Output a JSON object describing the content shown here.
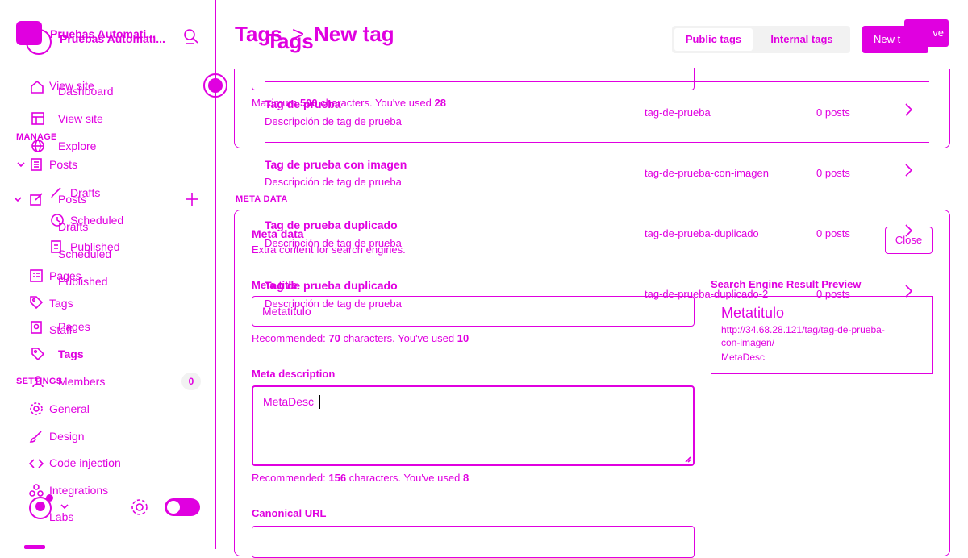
{
  "sidebar": {
    "site_title_a": "Pruebas Automati...",
    "site_title_b": "Pruebas Automati...",
    "search_label": "search",
    "nav_a": {
      "dashboard": "Dashboard",
      "view_site": "View site",
      "explore": "Explore",
      "posts": "Posts",
      "drafts": "Drafts",
      "scheduled": "Scheduled",
      "published": "Published",
      "pages": "Pages",
      "tags": "Tags",
      "staff": "Staff"
    },
    "nav_b": {
      "view_site": "View site",
      "section_manage": "MANAGE",
      "posts": "Posts",
      "drafts": "Drafts",
      "scheduled": "Scheduled",
      "published": "Published",
      "pages": "Pages",
      "tags": "Tags",
      "members": "Members",
      "members_count": "0",
      "section_settings": "SETTINGS",
      "general": "General",
      "design": "Design",
      "code_injection": "Code injection",
      "integrations": "Integrations",
      "labs": "Labs"
    }
  },
  "header": {
    "breadcrumb_root": "Tags",
    "breadcrumb_sep": ">",
    "breadcrumb_current": "New tag",
    "title_b": "Tags",
    "tab_public": "Public tags",
    "tab_internal": "Internal tags",
    "new_tag_button": "New t",
    "save_button": "ve"
  },
  "tags_list": [
    {
      "name": "Tag de prueba",
      "description": "Descripción de tag de prueba",
      "slug": "tag-de-prueba",
      "count": "0 posts"
    },
    {
      "name": "Tag de prueba con imagen",
      "description": "Descripción de tag de prueba",
      "slug": "tag-de-prueba-con-imagen",
      "count": "0 posts"
    },
    {
      "name": "Tag de prueba duplicado",
      "description": "Descripción de tag de prueba",
      "slug": "tag-de-prueba-duplicado",
      "count": "0 posts"
    },
    {
      "name": "Tag de prueba duplicado",
      "description": "Descripción de tag de prueba",
      "slug": "tag-de-prueba-duplicado-2",
      "count": "0 posts"
    }
  ],
  "form": {
    "description_hint_prefix": "Maximum ",
    "description_hint_max": "500",
    "description_hint_mid": " characters. You've used ",
    "description_hint_used": "28",
    "meta_section_label": "META DATA",
    "meta_title": "Meta data",
    "meta_subtitle": "Extra content for search engines.",
    "close_button": "Close",
    "meta_title_label": "Meta title",
    "meta_title_value": "Metatitulo",
    "meta_title_hint_prefix": "Recommended: ",
    "meta_title_hint_max": "70",
    "meta_title_hint_mid": " characters. You've used ",
    "meta_title_hint_used": "10",
    "meta_desc_label": "Meta description",
    "meta_desc_value": "MetaDesc",
    "meta_desc_hint_prefix": "Recommended: ",
    "meta_desc_hint_max": "156",
    "meta_desc_hint_mid": " characters. You've used ",
    "meta_desc_hint_used": "8",
    "canonical_label": "Canonical URL",
    "canonical_value": ""
  },
  "preview": {
    "heading": "Search Engine Result Preview",
    "title": "Metatitulo",
    "url_line1": "http://34.68.28.121/tag/tag-de-prueba-",
    "url_line2": "con-imagen/",
    "description": "MetaDesc"
  },
  "colors": {
    "accent": "#e000e0",
    "background": "#ffffff"
  }
}
